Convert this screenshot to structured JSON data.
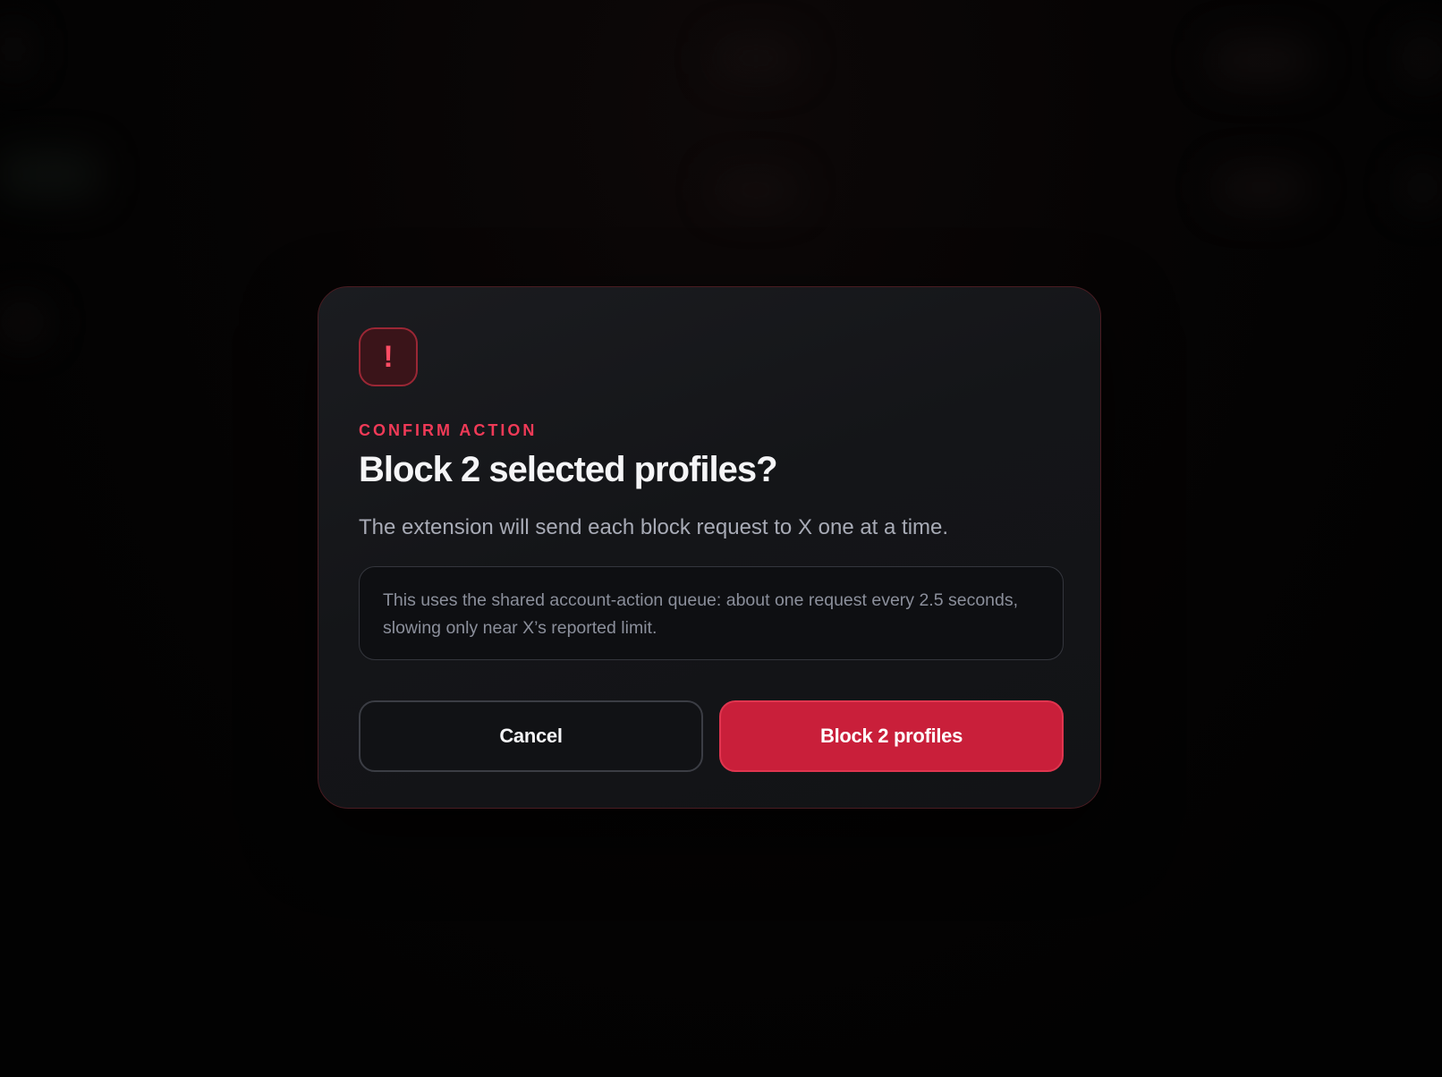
{
  "dialog": {
    "icon": "exclamation-icon",
    "icon_glyph": "!",
    "eyebrow": "CONFIRM ACTION",
    "title": "Block 2 selected profiles?",
    "description": "The extension will send each block request to X one at a time.",
    "note": "This uses the shared account-action queue: about one request every 2.5 seconds, slowing only near X’s reported limit.",
    "cancel_label": "Cancel",
    "confirm_label": "Block 2 profiles"
  },
  "colors": {
    "accent": "#f03a57",
    "danger_button": "#c91f3a",
    "modal_background": "#141518",
    "page_background": "#030303"
  }
}
